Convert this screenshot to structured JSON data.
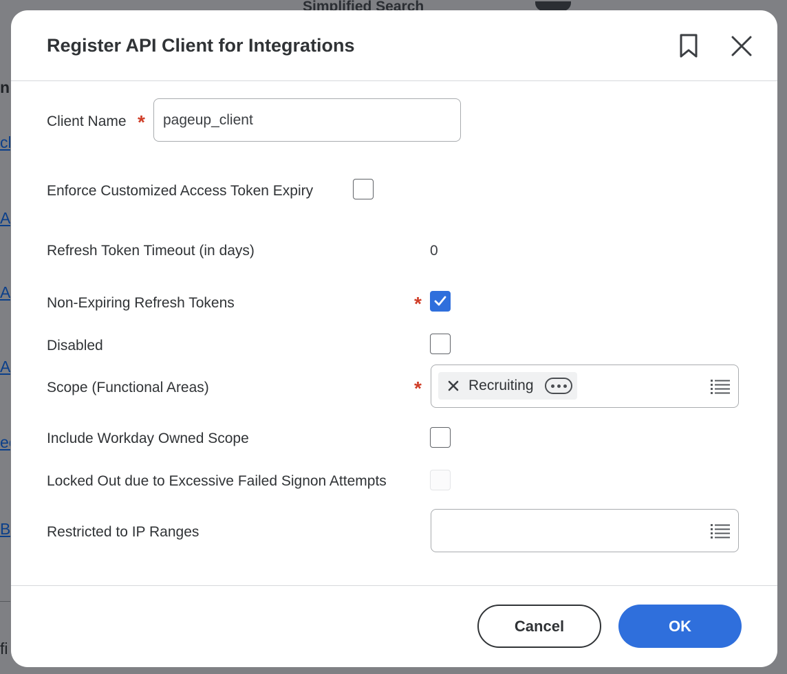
{
  "background": {
    "top_label": "Simplified Search",
    "fragments": [
      "nd",
      "cli",
      "AP",
      "AP",
      "AP",
      "ec",
      "B T",
      "fi"
    ]
  },
  "modal": {
    "title": "Register API Client for Integrations",
    "bookmark_icon": "bookmark-icon",
    "close_icon": "close-icon"
  },
  "form": {
    "client_name": {
      "label": "Client Name",
      "required": true,
      "value": "pageup_client"
    },
    "enforce_expiry": {
      "label": "Enforce Customized Access Token Expiry",
      "checked": false
    },
    "refresh_timeout": {
      "label": "Refresh Token Timeout (in days)",
      "value": "0"
    },
    "non_expiring": {
      "label": "Non-Expiring Refresh Tokens",
      "required": true,
      "checked": true
    },
    "disabled": {
      "label": "Disabled",
      "checked": false
    },
    "scope": {
      "label": "Scope (Functional Areas)",
      "required": true,
      "selected": [
        "Recruiting"
      ]
    },
    "workday_owned": {
      "label": "Include Workday Owned Scope",
      "checked": false
    },
    "locked_out": {
      "label": "Locked Out due to Excessive Failed Signon Attempts",
      "checked": false,
      "disabled": true
    },
    "ip_ranges": {
      "label": "Restricted to IP Ranges",
      "selected": []
    }
  },
  "footer": {
    "cancel_label": "Cancel",
    "ok_label": "OK"
  },
  "colors": {
    "accent": "#2f6fdc",
    "required": "#d03e28",
    "text": "#303336"
  }
}
